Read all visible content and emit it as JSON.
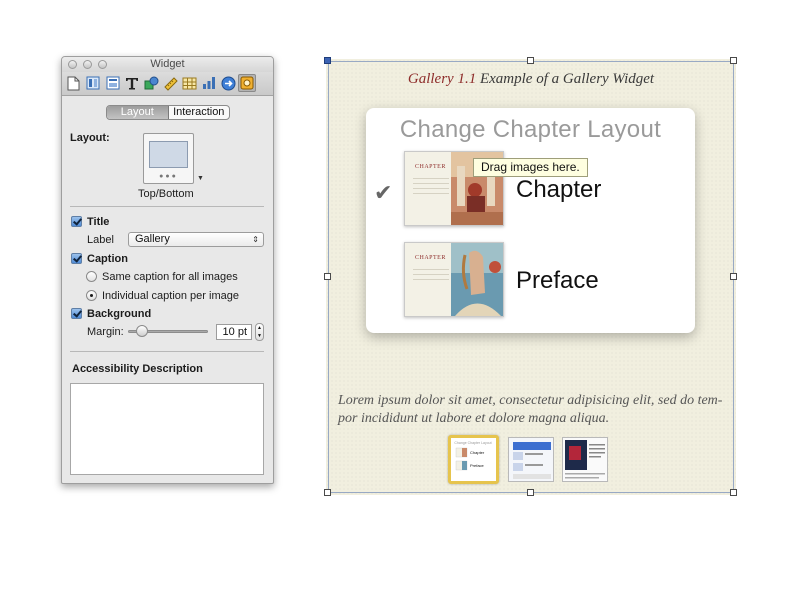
{
  "window": {
    "title": "Widget"
  },
  "toolbar": {
    "buttons": [
      "document-icon",
      "metrics-icon",
      "layout-icon",
      "text-icon",
      "graphic-icon",
      "ruler-icon",
      "table-icon",
      "chart-icon",
      "link-icon",
      "widget-icon"
    ],
    "selected": "widget-icon"
  },
  "tabs": {
    "layout": "Layout",
    "interaction": "Interaction",
    "active": "Layout"
  },
  "layout_section": {
    "label": "Layout:",
    "option": "Top/Bottom"
  },
  "title_section": {
    "checkbox_label": "Title",
    "checked": true,
    "label_text": "Label",
    "select_value": "Gallery"
  },
  "caption_section": {
    "checkbox_label": "Caption",
    "checked": true,
    "option_same": "Same caption for all images",
    "option_individual": "Individual caption per image",
    "selected": "Individual caption per image"
  },
  "background_section": {
    "checkbox_label": "Background",
    "checked": true,
    "margin_label": "Margin:",
    "margin_value": "10 pt"
  },
  "accessibility": {
    "label": "Accessibility Description",
    "value": ""
  },
  "widget": {
    "title_number": "Gallery 1.1",
    "title_text": " Example of a Gallery Widget",
    "card_title": "Change Chapter Layout",
    "tooltip": "Drag images here.",
    "rows": [
      {
        "label": "Chapter",
        "checked": true,
        "thumb_text": "CHAPTER"
      },
      {
        "label": "Preface",
        "checked": false,
        "thumb_text": "CHAPTER"
      }
    ],
    "checkmark": "✔",
    "caption": "Lorem ipsum dolor sit amet, consectetur adipisicing elit, sed do tem-por incididunt ut labore et dolore magna aliqua.",
    "thumbnails": [
      {
        "title": "Change Chapter Layout",
        "row1": "Chapter",
        "row2": "Preface",
        "selected": true
      },
      {
        "selected": false
      },
      {
        "selected": false
      }
    ],
    "thumbnail_count": 3
  },
  "colors": {
    "accent_red": "#8e2d2b",
    "canvas_bg": "#f1efdf",
    "selection_gold": "#e6c44d",
    "checkbox_blue": "#4f8bd6"
  }
}
